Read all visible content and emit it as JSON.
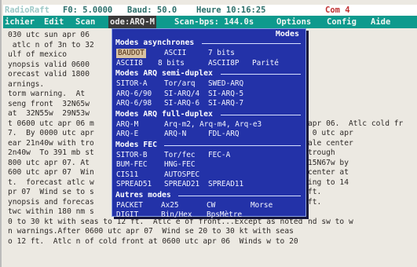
{
  "statusbar": {
    "left": "RadioRaft",
    "freq": "F0: 5.0000",
    "baud": "Baud: 50.0",
    "time": "Heure 10:16:25",
    "right": "Com 4"
  },
  "menubar": {
    "items": [
      "ichier",
      "Edit",
      "Scan",
      "ode:ARQ-M",
      "Scan-bps: 144.0s",
      "Options",
      "Config",
      "Aide"
    ]
  },
  "text_lines": [
    "030 utc sun apr 06",
    " atlc n of 3n to 32",
    "ulf of mexico",
    "ynopsis valid 0600",
    "orecast valid 1800",
    "arnings.",
    "torm warning.  At",
    "seng front  32N65w",
    "at  32N55w  29N53w",
    "t 0600 utc apr 06 m",
    "7.  By 0000 utc apr",
    "ear 21n40w with tro",
    "2n40w  To 391 mb st",
    "800 utc apr 07. At",
    "600 utc apr 07  Win",
    "t.  forecast atlc w",
    "pr 07  Wind se to s",
    "ynopsis and forecas",
    "twc within 180 nm s",
    "0 to 30 kt with seas to 12 ft.  Atlc e of front...Except as noted",
    "n warnings.After 0600 utc apr 07  Wind se 20 to 30 kt with seas",
    "o 12 ft.  Atlc n of cold front at 0600 utc apr 06  Winds w to 20"
  ],
  "right_lines": [
    {
      "row": 9,
      "text": "apr 06.  Atlc cold fr"
    },
    {
      "row": 10,
      "text": " 0 utc apr"
    },
    {
      "row": 11,
      "text": "ale center"
    },
    {
      "row": 12,
      "text": "trough"
    },
    {
      "row": 13,
      "text": "15N67w by"
    },
    {
      "row": 14,
      "text": "center at"
    },
    {
      "row": 15,
      "text": "ing to 14"
    },
    {
      "row": 16,
      "text": "ft."
    },
    {
      "row": 17,
      "text": "ft."
    },
    {
      "row": 19,
      "text": "nd sw to w"
    }
  ],
  "dialog": {
    "title": "Modes",
    "sections": [
      {
        "header": "Modes asynchrones",
        "rows": [
          [
            "BAUDOT",
            "ASCII",
            "7 bits"
          ],
          [
            "ASCII8",
            "8 bits",
            "ASCII8P",
            "Parité"
          ]
        ]
      },
      {
        "header": "Modes ARQ semi-duplex",
        "rows": [
          [
            "SITOR-A",
            "Tor/arq",
            "SWED-ARQ"
          ],
          [
            "ARQ-6/90",
            "SI-ARQ/4",
            "SI-ARQ-5"
          ],
          [
            "ARQ-6/98",
            "SI-ARQ-6",
            "SI-ARQ-7"
          ]
        ]
      },
      {
        "header": "Modes ARQ full-duplex",
        "rows": [
          [
            "ARQ-M",
            "Arq-m2, Arq-m4, Arq-e3"
          ],
          [
            "ARQ-E",
            "ARQ-N",
            "FDL-ARQ"
          ]
        ]
      },
      {
        "header": "Modes FEC",
        "rows": [
          [
            "SITOR-B",
            "Tor/fec",
            "FEC-A"
          ],
          [
            "BUM-FEC",
            "HNG-FEC"
          ],
          [
            "CIS11",
            "AUTOSPEC"
          ],
          [
            "SPREAD51",
            "SPREAD21",
            "SPREAD11"
          ]
        ]
      },
      {
        "header": "Autres modes",
        "rows": [
          [
            "PACKET",
            "Ax25",
            "CW",
            "Morse"
          ],
          [
            "DIGIT",
            "Bin/Hex",
            "BpsMètre"
          ]
        ]
      }
    ]
  },
  "colors": {
    "dialog_bg": "#2332a8",
    "menubar_bg": "#0e9a8d",
    "selection_bg": "#d8c2a2",
    "text_bg": "#ece9e2"
  }
}
